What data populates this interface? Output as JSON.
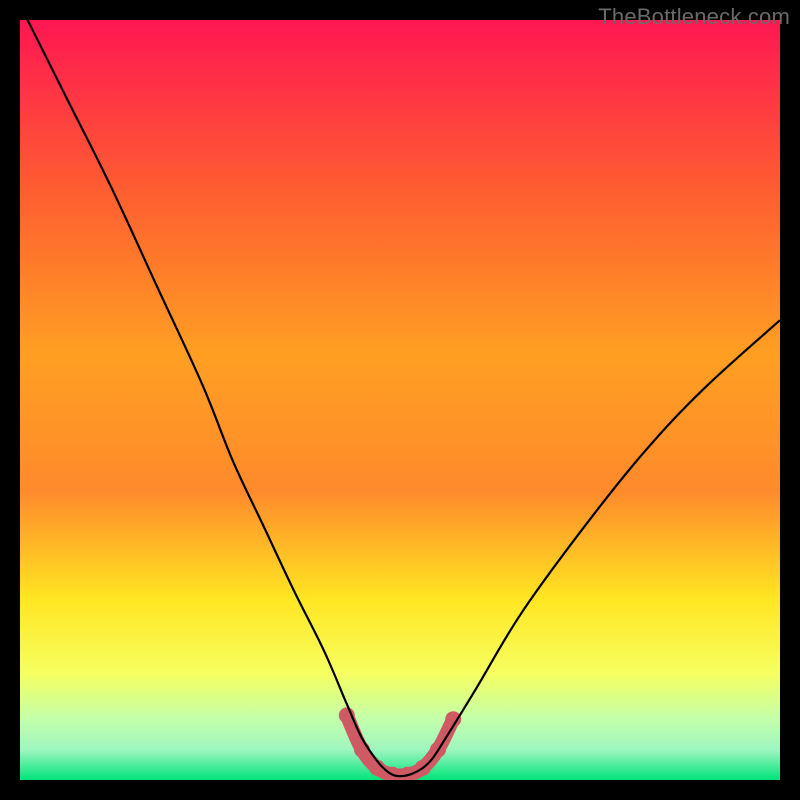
{
  "watermark": "TheBottleneck.com",
  "chart_data": {
    "type": "line",
    "title": "",
    "xlabel": "",
    "ylabel": "",
    "xlim": [
      0,
      100
    ],
    "ylim": [
      0,
      100
    ],
    "grid": false,
    "legend": false,
    "annotations": [],
    "series": [
      {
        "name": "bottleneck-curve",
        "x": [
          0,
          6,
          12,
          18,
          24,
          28,
          32,
          36,
          40,
          43,
          45,
          47,
          48.5,
          50,
          52,
          54,
          56,
          60,
          66,
          74,
          82,
          90,
          100
        ],
        "values": [
          102,
          90,
          78,
          65,
          52,
          42,
          33.5,
          25,
          17,
          10,
          5.5,
          2.5,
          1,
          0.5,
          1,
          2.5,
          5.5,
          12,
          22,
          33,
          43,
          51.5,
          60.5
        ]
      },
      {
        "name": "optimal-range-markers",
        "x": [
          43,
          45,
          47,
          49,
          51,
          53,
          55,
          57
        ],
        "values": [
          8.5,
          4.0,
          1.6,
          0.7,
          0.7,
          1.6,
          4.0,
          8.0
        ]
      }
    ],
    "background_gradient": {
      "top": "#ff1752",
      "mid_upper": "#ff8a2b",
      "mid": "#ffe521",
      "mid_lower": "#f6ff60",
      "near_bottom": "#c3ffab",
      "bottom": "#00e47a"
    }
  }
}
